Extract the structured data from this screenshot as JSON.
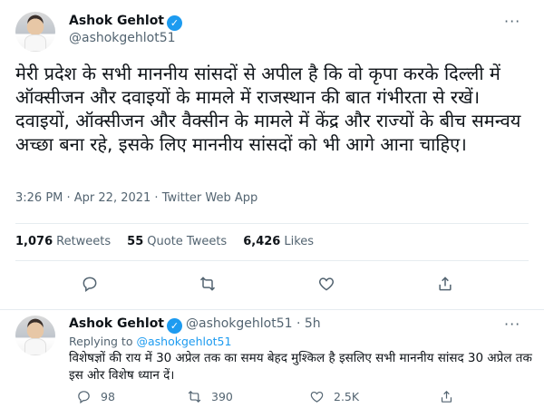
{
  "main_tweet": {
    "name": "Ashok Gehlot",
    "handle": "@ashokgehlot51",
    "text": "मेरी प्रदेश के सभी माननीय सांसदों से अपील है कि वो कृपा करके दिल्ली में ऑक्सीजन और दवाइयों के मामले में राजस्थान की बात गंभीरता से रखें। दवाइयों, ऑक्सीजन और वैक्सीन के मामले में केंद्र और राज्यों के बीच समन्वय अच्छा बना रहे, इसके लिए माननीय सांसदों को भी आगे आना चाहिए।",
    "meta": "3:26 PM · Apr 22, 2021 · Twitter Web App",
    "stats": {
      "retweets_count": "1,076",
      "retweets_label": "Retweets",
      "quotes_count": "55",
      "quotes_label": "Quote Tweets",
      "likes_count": "6,426",
      "likes_label": "Likes"
    }
  },
  "reply_tweet": {
    "name": "Ashok Gehlot",
    "handle": "@ashokgehlot51 · 5h",
    "replying_prefix": "Replying to",
    "replying_handle": "@ashokgehlot51",
    "text": "विशेषज्ञों की राय में 30 अप्रेल तक का समय बेहद मुश्किल है इसलिए सभी माननीय सांसद 30 अप्रेल तक इस ओर विशेष ध्यान दें।",
    "counts": {
      "replies": "98",
      "retweets": "390",
      "likes": "2.5K"
    }
  },
  "icons": {
    "verified": "verified-badge-icon",
    "more": "more-options-icon",
    "reply": "reply-icon",
    "retweet": "retweet-icon",
    "like": "heart-icon",
    "share": "share-icon"
  },
  "colors": {
    "accent": "#1d9bf0",
    "muted": "#536471",
    "text": "#0f1419",
    "divider": "#e6ecf0"
  }
}
